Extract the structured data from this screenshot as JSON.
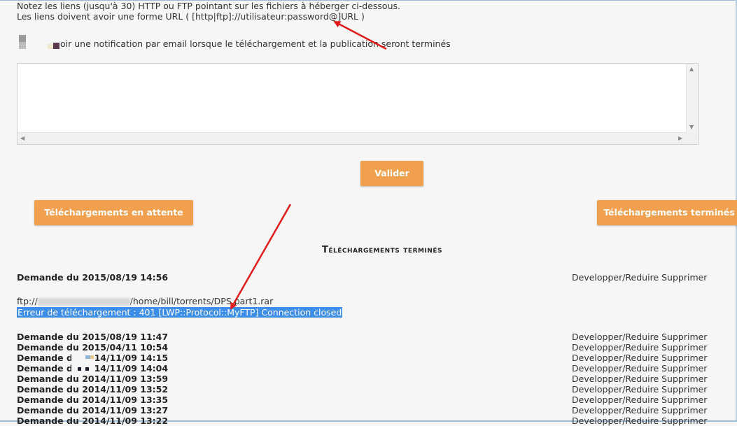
{
  "instructions": {
    "line1": "Notez les liens (jusqu'à 30) HTTP ou FTP pointant sur les fichiers à héberger ci-dessous.",
    "line2": "Les liens doivent avoir une forme URL ( [http|ftp]://utilisateur:password@]URL )"
  },
  "notify": {
    "label": "oir une notification par email lorsque le téléchargement et la publication seront terminés"
  },
  "textarea": {
    "value": ""
  },
  "buttons": {
    "valider": "Valider",
    "en_attente": "Téléchargements en attente",
    "termines": "Téléchargements terminés"
  },
  "section": {
    "title": "Téléchargements terminés"
  },
  "first_entry": {
    "label": "Demande du 2015/08/19 14:56",
    "actions": "Developper/Reduire Supprimer",
    "ftp_prefix": "ftp://",
    "ftp_path": "/home/bill/torrents/DPS.part1.rar",
    "error": "Erreur de téléchargement : 401 [LWP::Protocol::MyFTP] Connection closed"
  },
  "entries": [
    {
      "label": "Demande du 2015/08/19 11:47",
      "actions": "Developper/Reduire Supprimer"
    },
    {
      "label": "Demande du 2015/04/11 10:54",
      "actions": "Developper/Reduire Supprimer"
    },
    {
      "label": "Demande du 2014/11/09 14:15",
      "actions": "Developper/Reduire Supprimer"
    },
    {
      "label": "Demande du 2014/11/09 14:04",
      "actions": "Developper/Reduire Supprimer"
    },
    {
      "label": "Demande du 2014/11/09 13:59",
      "actions": "Developper/Reduire Supprimer"
    },
    {
      "label": "Demande du 2014/11/09 13:52",
      "actions": "Developper/Reduire Supprimer"
    },
    {
      "label": "Demande du 2014/11/09 13:35",
      "actions": "Developper/Reduire Supprimer"
    },
    {
      "label": "Demande du 2014/11/09 13:27",
      "actions": "Developper/Reduire Supprimer"
    },
    {
      "label": "Demande du 2014/11/09 13:22",
      "actions": "Developper/Reduire Supprimer"
    }
  ],
  "colors": {
    "accent": "#f0a04e",
    "selection": "#3d8ee8",
    "annotation_arrow": "#e01b1b"
  },
  "icons": {
    "scroll_up": "▲",
    "scroll_down": "▼",
    "scroll_left": "◀",
    "scroll_right": "▶"
  }
}
